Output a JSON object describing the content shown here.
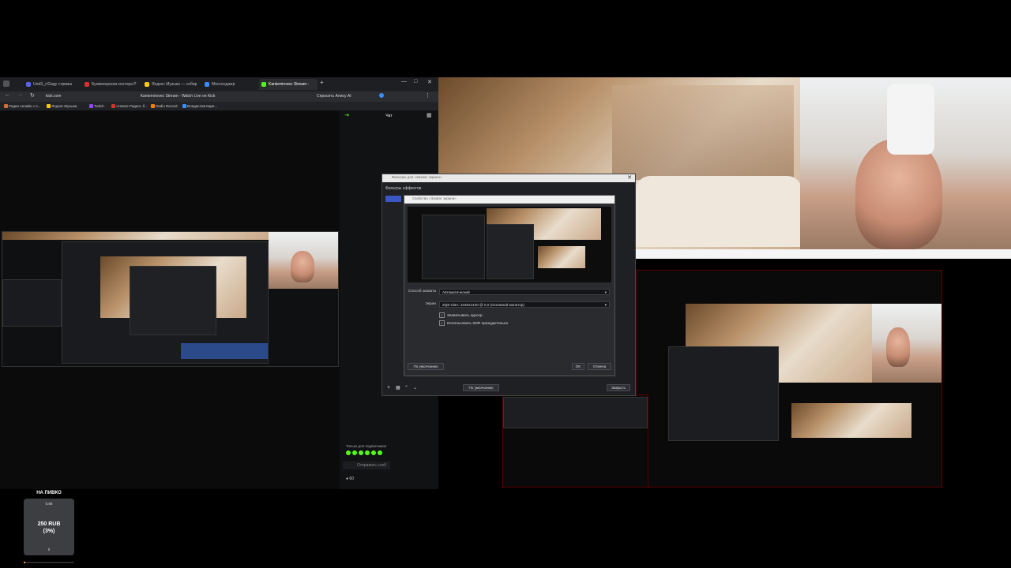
{
  "browser": {
    "tabs": [
      {
        "label": "UndS_r/Gagy стримы",
        "color": "#5865f2"
      },
      {
        "label": "Букмекерская контора Р",
        "color": "#d4332d"
      },
      {
        "label": "Яндекс Музыка — собир",
        "color": "#ffcc00"
      },
      {
        "label": "Мессенджер",
        "color": "#3a8cff"
      },
      {
        "label": "Kantemirovec Stream -",
        "color": "#53fc18"
      }
    ],
    "new_tab": "+",
    "url": "kick.com",
    "page_title": "Kantemirovec Stream - Watch Live on Kick",
    "ask_alice": "Спросить Алису AI",
    "bookmarks": [
      {
        "label": "Радио онлайн с п...",
        "color": "#e06a2b"
      },
      {
        "label": "Яндекс Музыка",
        "color": "#ffcc00"
      },
      {
        "label": "Twitch",
        "color": "#9146ff"
      },
      {
        "label": "«Новое Радио» б...",
        "color": "#d4332d"
      },
      {
        "label": "Radio Record",
        "color": "#ff7a00"
      },
      {
        "label": "Владислав Кири...",
        "color": "#3a8cff"
      }
    ]
  },
  "chat": {
    "title": "Чат",
    "subs_only": "Только для подписчиков",
    "send_placeholder": "Отправить сооб",
    "viewer_count": "60",
    "accent": "#53fc18"
  },
  "obs_dialog": {
    "title": "Фильтры для «Захват экрана»",
    "filters_label": "Фильтры эффектов",
    "inner_title": "Свойства «Захват экрана»",
    "capture_method_label": "Способ захвата",
    "capture_method_value": "Автоматический",
    "screen_label": "Экран",
    "screen_value": "ZQE-CBA: 3440x1440 @ 0,0 (Основной монитор)",
    "capture_cursor": "Захватывать курсор",
    "force_sdr": "Использовать SDR принудительно",
    "defaults_button": "По умолчанию",
    "ok_button": "OK",
    "cancel_button": "Отмена",
    "outer_defaults_button": "По умолчанию",
    "close_button": "Закрыть"
  },
  "donation": {
    "title": "НА ПИВКО",
    "small_value": "0.88",
    "amount": "250 RUB",
    "percent": "(3%)",
    "bottom_value": "0",
    "progress": 0.03,
    "accent": "#f2a23a"
  }
}
